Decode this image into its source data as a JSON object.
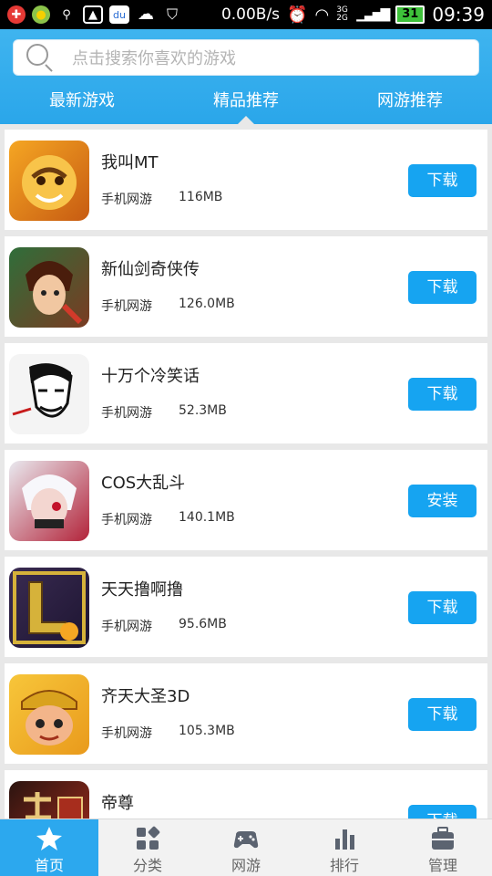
{
  "status_bar": {
    "speed": "0.00B/s",
    "network": "3G 2G",
    "battery": "31",
    "time": "09:39",
    "icons": [
      "plus-icon",
      "weather-icon",
      "search-icon",
      "image-icon",
      "du-icon",
      "cloud-icon",
      "shield-icon",
      "alarm-icon",
      "wifi-icon",
      "signal-icon"
    ]
  },
  "search": {
    "placeholder": "点击搜索你喜欢的游戏"
  },
  "tabs": [
    {
      "label": "最新游戏"
    },
    {
      "label": "精品推荐",
      "active": true
    },
    {
      "label": "网游推荐"
    }
  ],
  "games": [
    {
      "name": "我叫MT",
      "category": "手机网游",
      "size": "116MB",
      "action": "下载",
      "icon_colors": [
        "#f5a623",
        "#c75b12"
      ]
    },
    {
      "name": "新仙剑奇侠传",
      "category": "手机网游",
      "size": "126.0MB",
      "action": "下载",
      "icon_colors": [
        "#7a3b22",
        "#2f6e3a"
      ]
    },
    {
      "name": "十万个冷笑话",
      "category": "手机网游",
      "size": "52.3MB",
      "action": "下载",
      "icon_colors": [
        "#f4f4f4",
        "#222222"
      ]
    },
    {
      "name": "COS大乱斗",
      "category": "手机网游",
      "size": "140.1MB",
      "action": "安装",
      "icon_colors": [
        "#e9e9ef",
        "#b3243a"
      ]
    },
    {
      "name": "天天撸啊撸",
      "category": "手机网游",
      "size": "95.6MB",
      "action": "下载",
      "icon_colors": [
        "#3a2b52",
        "#d6b23a"
      ]
    },
    {
      "name": "齐天大圣3D",
      "category": "手机网游",
      "size": "105.3MB",
      "action": "下载",
      "icon_colors": [
        "#f7c63a",
        "#c2411a"
      ]
    },
    {
      "name": "帝尊",
      "category": "",
      "size": "",
      "action": "下载",
      "icon_colors": [
        "#2b1410",
        "#a72d1d"
      ]
    }
  ],
  "nav": [
    {
      "label": "首页",
      "icon": "star-icon",
      "active": true
    },
    {
      "label": "分类",
      "icon": "category-grid-icon"
    },
    {
      "label": "网游",
      "icon": "gamepad-icon"
    },
    {
      "label": "排行",
      "icon": "bar-chart-icon"
    },
    {
      "label": "管理",
      "icon": "toolbox-icon"
    }
  ],
  "colors": {
    "accent": "#16a4f1",
    "header": "#2aa6ea",
    "nav_active": "#2ca8ee"
  }
}
